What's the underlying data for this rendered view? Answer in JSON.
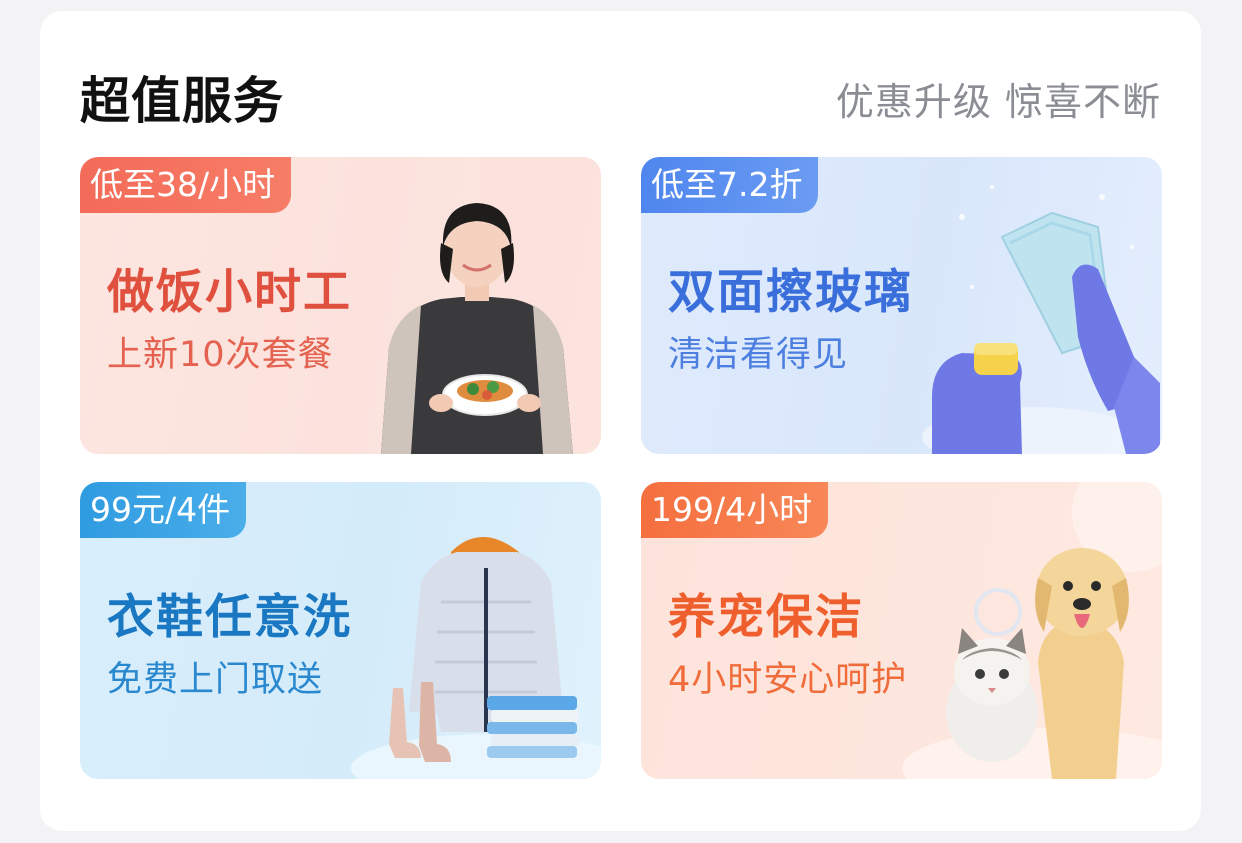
{
  "header": {
    "title": "超值服务",
    "subtitle": "优惠升级 惊喜不断"
  },
  "services": [
    {
      "badge": "低至38/小时",
      "title": "做饭小时工",
      "subtitle": "上新10次套餐",
      "image": "woman-holding-plate-of-food",
      "accent": "#e0503f"
    },
    {
      "badge": "低至7.2折",
      "title": "双面擦玻璃",
      "subtitle": "清洁看得见",
      "image": "gloved-hands-cleaning-glass",
      "accent": "#3a6fdb"
    },
    {
      "badge": "99元/4件",
      "title": "衣鞋任意洗",
      "subtitle": "免费上门取送",
      "image": "down-jacket-boots-folded-clothes",
      "accent": "#1a77c2"
    },
    {
      "badge": "199/4小时",
      "title": "养宠保洁",
      "subtitle": "4小时安心呵护",
      "image": "puppy-and-kitten",
      "accent": "#ef5f2d"
    }
  ]
}
